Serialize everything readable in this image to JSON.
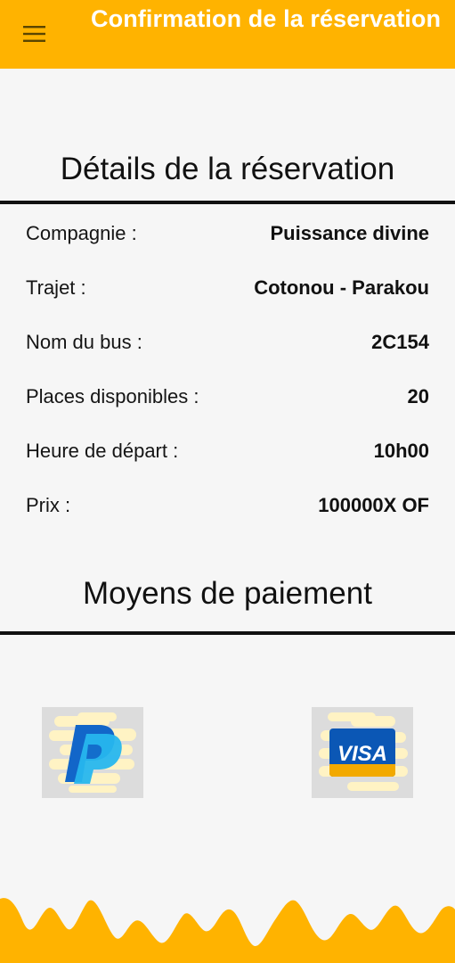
{
  "header": {
    "title": "Confirmation de la réservation",
    "menu_icon": "hamburger-menu-icon",
    "background": "#ffb300"
  },
  "details": {
    "title": "Détails de la réservation",
    "rows": [
      {
        "label": "Compagnie :",
        "value": "Puissance divine"
      },
      {
        "label": "Trajet :",
        "value": "Cotonou - Parakou"
      },
      {
        "label": "Nom du bus :",
        "value": "2C154"
      },
      {
        "label": "Places disponibles :",
        "value": "20"
      },
      {
        "label": "Heure de départ :",
        "value": "10h00"
      },
      {
        "label": "Prix :",
        "value": "100000X OF"
      }
    ]
  },
  "payment": {
    "title": "Moyens de paiement",
    "methods": [
      {
        "name": "PayPal",
        "icon": "paypal-logo-icon"
      },
      {
        "name": "VISA",
        "icon": "visa-logo-icon",
        "text": "VISA"
      }
    ]
  },
  "colors": {
    "accent": "#ffb300",
    "background": "#f6f6f6",
    "text": "#111111"
  }
}
